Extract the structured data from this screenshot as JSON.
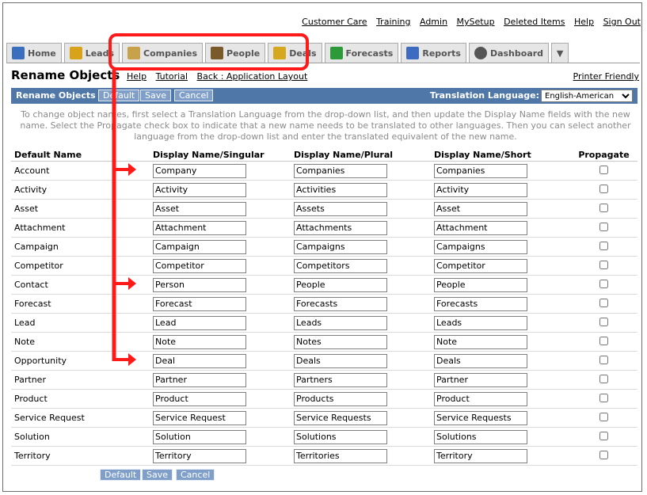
{
  "toplinks": [
    "Customer Care",
    "Training",
    "Admin",
    "MySetup",
    "Deleted Items",
    "Help",
    "Sign Out"
  ],
  "tabs": [
    {
      "label": "Home",
      "icon": "home-icon",
      "color": "#3a6fbf"
    },
    {
      "label": "Leads",
      "icon": "question-icon",
      "color": "#d9a21b"
    },
    {
      "label": "Companies",
      "icon": "building-icon",
      "color": "#c8a24a"
    },
    {
      "label": "People",
      "icon": "people-icon",
      "color": "#7a5a2a"
    },
    {
      "label": "Deals",
      "icon": "coins-icon",
      "color": "#d6a820"
    },
    {
      "label": "Forecasts",
      "icon": "trend-chart-icon",
      "color": "#2d9a3a"
    },
    {
      "label": "Reports",
      "icon": "report-chart-icon",
      "color": "#3d6bc2"
    },
    {
      "label": "Dashboard",
      "icon": "gauge-icon",
      "color": "#555555"
    }
  ],
  "page": {
    "title": "Rename Objects",
    "links": [
      "Help",
      "Tutorial",
      "Back : Application Layout"
    ],
    "printer": "Printer Friendly"
  },
  "bar": {
    "label": "Rename Objects",
    "default": "Default",
    "save": "Save",
    "cancel": "Cancel",
    "translation_label": "Translation Language:",
    "translation_value": "English-American"
  },
  "help_text": "To change object names, first select a Translation Language from the drop-down list, and then update the Display Name fields with the new name. Select the Propagate check box to indicate that a new name needs to be translated to other languages. Then you can select another language from the drop-down list and enter the translated equivalent of the new name.",
  "columns": [
    "Default Name",
    "Display Name/Singular",
    "Display Name/Plural",
    "Display Name/Short",
    "Propagate"
  ],
  "rows": [
    [
      "Account",
      "Company",
      "Companies",
      "Companies"
    ],
    [
      "Activity",
      "Activity",
      "Activities",
      "Activity"
    ],
    [
      "Asset",
      "Asset",
      "Assets",
      "Asset"
    ],
    [
      "Attachment",
      "Attachment",
      "Attachments",
      "Attachment"
    ],
    [
      "Campaign",
      "Campaign",
      "Campaigns",
      "Campaigns"
    ],
    [
      "Competitor",
      "Competitor",
      "Competitors",
      "Competitor"
    ],
    [
      "Contact",
      "Person",
      "People",
      "People"
    ],
    [
      "Forecast",
      "Forecast",
      "Forecasts",
      "Forecasts"
    ],
    [
      "Lead",
      "Lead",
      "Leads",
      "Leads"
    ],
    [
      "Note",
      "Note",
      "Notes",
      "Note"
    ],
    [
      "Opportunity",
      "Deal",
      "Deals",
      "Deals"
    ],
    [
      "Partner",
      "Partner",
      "Partners",
      "Partner"
    ],
    [
      "Product",
      "Product",
      "Products",
      "Product"
    ],
    [
      "Service Request",
      "Service Request",
      "Service Requests",
      "Service Requests"
    ],
    [
      "Solution",
      "Solution",
      "Solutions",
      "Solutions"
    ],
    [
      "Territory",
      "Territory",
      "Territories",
      "Territory"
    ]
  ],
  "bottom": {
    "default": "Default",
    "save": "Save",
    "cancel": "Cancel"
  },
  "colors": {
    "bar": "#4f77a8",
    "highlight": "#ff1a1a",
    "button": "#7f9fc9"
  }
}
